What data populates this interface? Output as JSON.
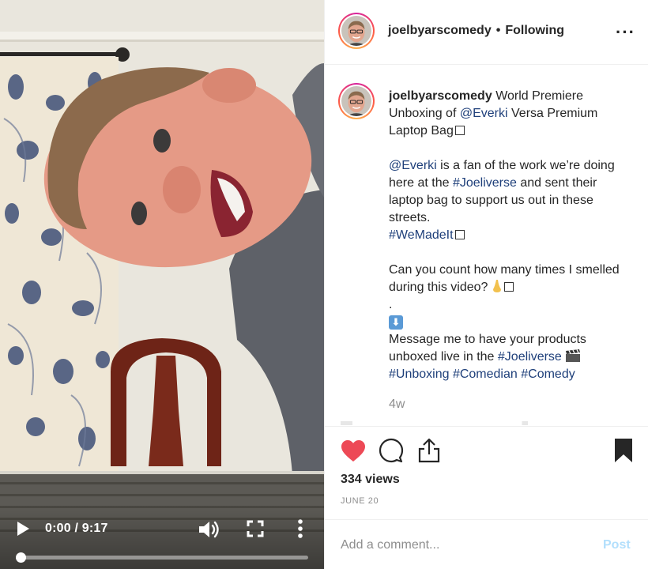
{
  "video": {
    "time_label": "0:00 / 9:17",
    "progress": 0.0,
    "icons": [
      "play-icon",
      "volume-icon",
      "fullscreen-icon",
      "more-vertical-icon"
    ]
  },
  "header": {
    "username": "joelbyarscomedy",
    "separator": "•",
    "follow_status": "Following",
    "more_label": "···"
  },
  "caption": {
    "username": "joelbyarscomedy",
    "line1": "World Premiere Unboxing of",
    "mention1": "@Everki",
    "line1_rest": "Versa Premium Laptop Bag",
    "mention2": "@Everki",
    "para2_a": "is a fan of the work we’re doing here at the",
    "tag_joeliverse1": "#Joeliverse",
    "para2_b": "and sent their laptop bag to support us out in these streets.",
    "tag_wemadeit": "#WeMadeIt",
    "para3": "Can you count how many times I smelled during this video?",
    "dot": ".",
    "para4_a": "Message me to have your products unboxed live in the",
    "tag_joeliverse2": "#Joeliverse",
    "tag_unboxing": "#Unboxing",
    "tag_comedian": "#Comedian",
    "tag_comedy": "#Comedy",
    "age": "4w"
  },
  "actions": {
    "icons": [
      "heart-icon",
      "comment-icon",
      "share-icon",
      "bookmark-icon"
    ],
    "views": "334 views",
    "date": "JUNE 20"
  },
  "comment_box": {
    "placeholder": "Add a comment...",
    "post_label": "Post"
  },
  "colors": {
    "like_red": "#ed4956",
    "link_blue": "#1e3f7a",
    "post_disabled": "#b2dffc",
    "muted_text": "#8e8e8e"
  }
}
